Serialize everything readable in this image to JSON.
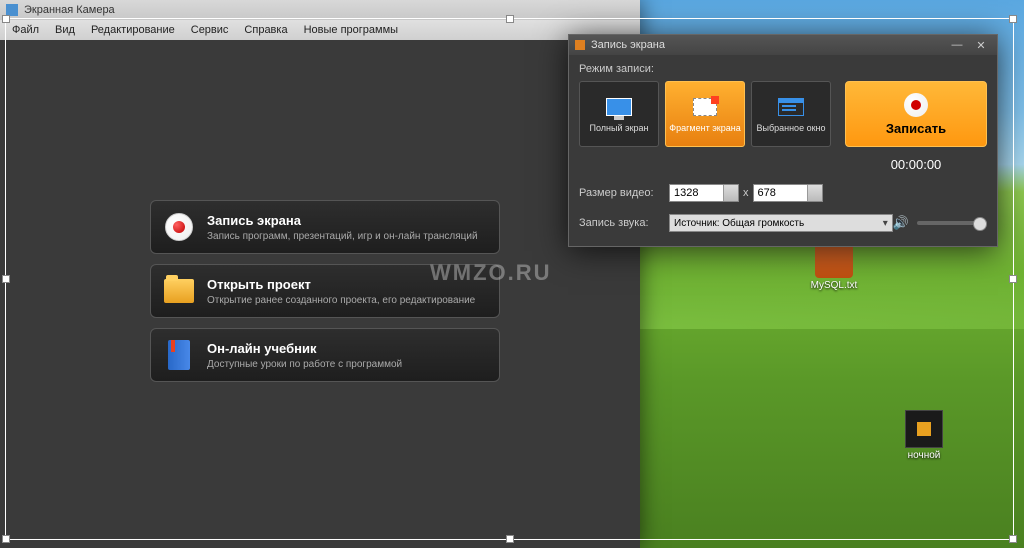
{
  "main_window": {
    "title": "Экранная Камера",
    "menu": [
      "Файл",
      "Вид",
      "Редактирование",
      "Сервис",
      "Справка",
      "Новые программы"
    ],
    "items": [
      {
        "title": "Запись экрана",
        "desc": "Запись программ, презентаций, игр и он-лайн трансляций"
      },
      {
        "title": "Открыть проект",
        "desc": "Открытие ранее созданного проекта, его редактирование"
      },
      {
        "title": "Он-лайн учебник",
        "desc": "Доступные уроки по работе с программой"
      }
    ]
  },
  "dialog": {
    "title": "Запись экрана",
    "mode_label": "Режим записи:",
    "modes": [
      "Полный экран",
      "Фрагмент экрана",
      "Выбранное окно"
    ],
    "record_label": "Записать",
    "timer": "00:00:00",
    "size_label": "Размер видео:",
    "width": "1328",
    "height": "678",
    "audio_label": "Запись звука:",
    "audio_source": "Источник: Общая громкость"
  },
  "watermark": "WMZO.RU",
  "desktop": {
    "icon1": "MySQL.txt",
    "icon2": "ночной"
  }
}
